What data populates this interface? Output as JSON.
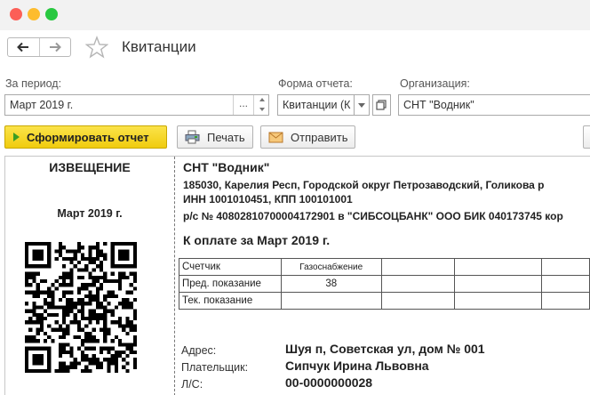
{
  "window": {
    "title": "Квитанции"
  },
  "filters": {
    "period_label": "За период:",
    "period_value": "Март 2019 г.",
    "period_select": "...",
    "form_label": "Форма отчета:",
    "form_value": "Квитанции (К",
    "org_label": "Организация:",
    "org_value": "СНТ \"Водник\""
  },
  "toolbar": {
    "generate_label": "Сформировать отчет",
    "print_label": "Печать",
    "send_label": "Отправить"
  },
  "receipt": {
    "notice_title": "ИЗВЕЩЕНИЕ",
    "period": "Март 2019 г.",
    "org_name": "СНТ \"Водник\"",
    "address_line": "185030, Карелия Респ, Городской округ Петрозаводский, Голикова р",
    "inn_line": "ИНН 1001010451, КПП 100101001",
    "bank_line": "р/с № 40802810700004172901 в \"СИБСОЦБАНК\" ООО БИК 040173745 кор",
    "due_title": "К оплате за Март 2019 г.",
    "meter_table": {
      "rows": [
        [
          "Счетчик",
          "Газоснабжение",
          "",
          "",
          ""
        ],
        [
          "Пред. показание",
          "38",
          "",
          "",
          ""
        ],
        [
          "Тек. показание",
          "",
          "",
          "",
          ""
        ]
      ]
    },
    "payer": {
      "address_label": "Адрес:",
      "address_value": "Шуя п, Советская ул, дом № 001",
      "payer_label": "Плательщик:",
      "payer_value": "Сипчук Ирина Львовна",
      "account_label": "Л/С:",
      "account_value": "00-0000000028"
    }
  },
  "colors": {
    "primary_button": "#f5d31c",
    "play_icon": "#3a9d23"
  }
}
